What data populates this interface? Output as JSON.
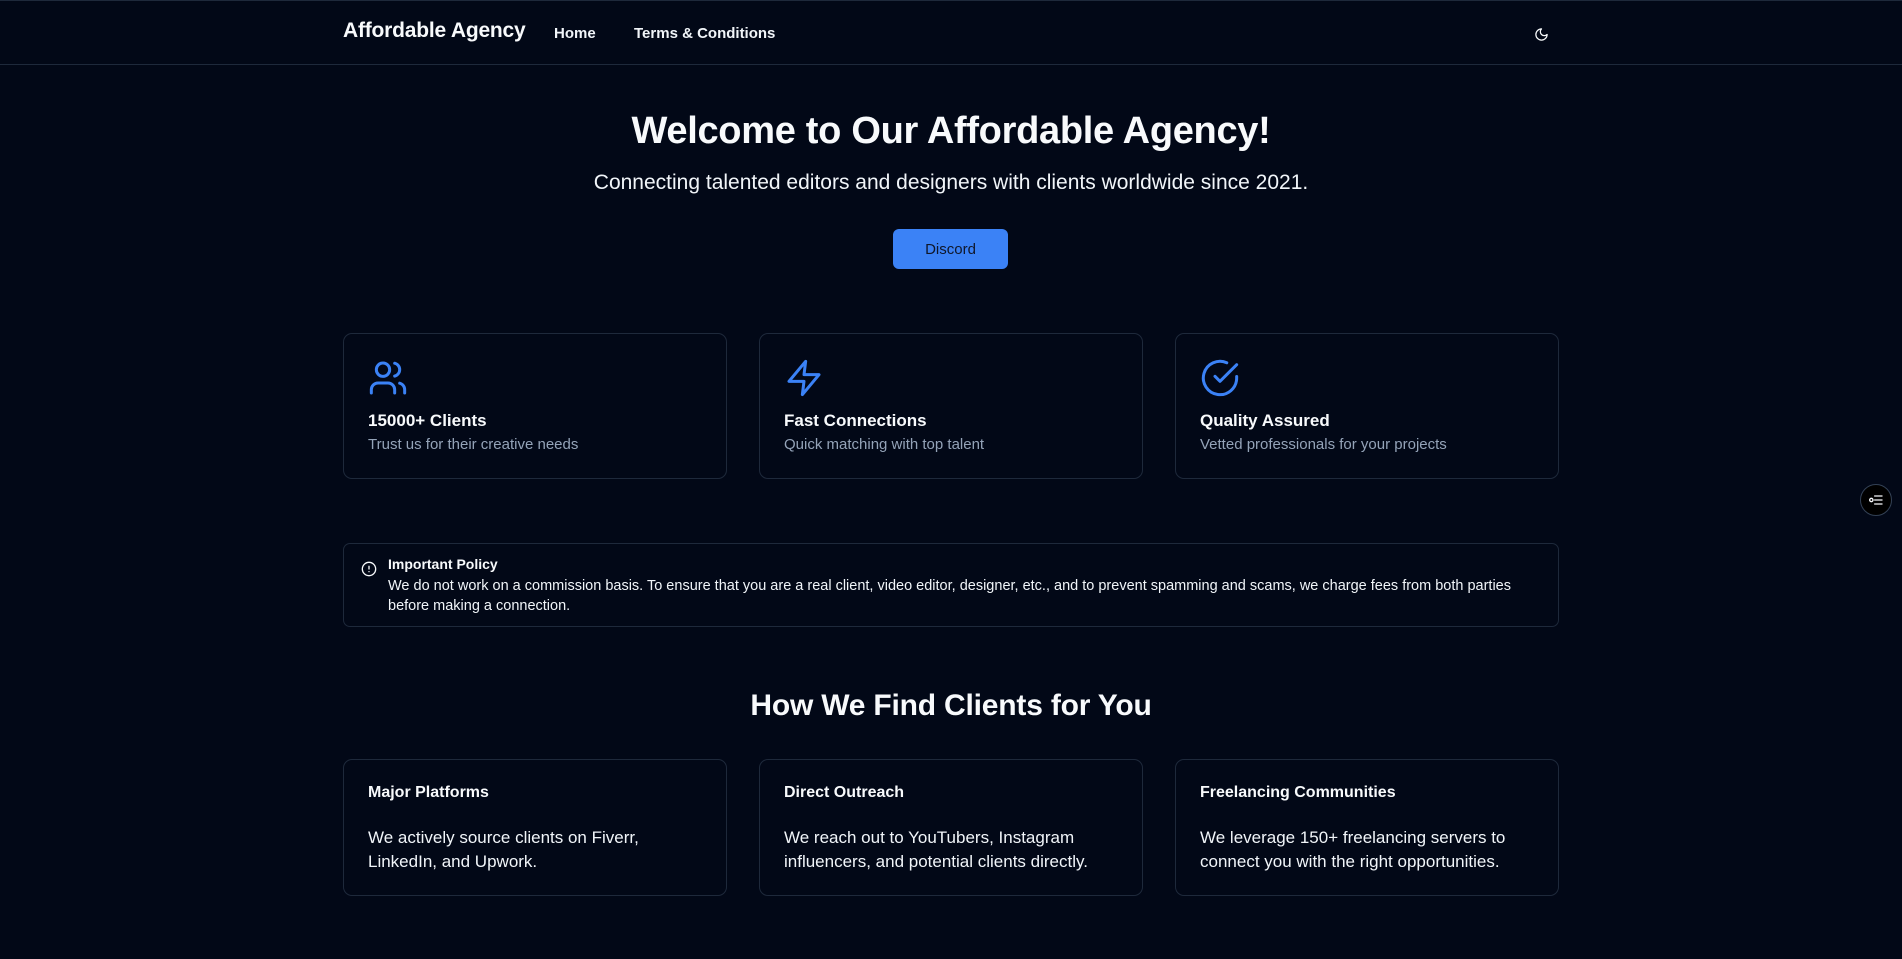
{
  "nav": {
    "brand": "Affordable Agency",
    "links": [
      "Home",
      "Terms & Conditions"
    ],
    "theme_toggle_icon": "moon-icon"
  },
  "hero": {
    "title": "Welcome to Our Affordable Agency!",
    "subtitle": "Connecting talented editors and designers with clients worldwide since 2021.",
    "button_label": "Discord"
  },
  "features": [
    {
      "icon": "users-icon",
      "title": "15000+ Clients",
      "desc": "Trust us for their creative needs"
    },
    {
      "icon": "lightning-icon",
      "title": "Fast Connections",
      "desc": "Quick matching with top talent"
    },
    {
      "icon": "check-circle-icon",
      "title": "Quality Assured",
      "desc": "Vetted professionals for your projects"
    }
  ],
  "policy": {
    "icon": "info-icon",
    "title": "Important Policy",
    "text": "We do not work on a commission basis. To ensure that you are a real client, video editor, designer, etc., and to prevent spamming and scams, we charge fees from both parties before making a connection."
  },
  "how": {
    "title": "How We Find Clients for You",
    "cards": [
      {
        "title": "Major Platforms",
        "desc": "We actively source clients on Fiverr, LinkedIn, and Upwork."
      },
      {
        "title": "Direct Outreach",
        "desc": "We reach out to YouTubers, Instagram influencers, and potential clients directly."
      },
      {
        "title": "Freelancing Communities",
        "desc": "We leverage 150+ freelancing servers to connect you with the right opportunities."
      }
    ]
  },
  "side_widget_icon": "accessibility-toggle-icon",
  "colors": {
    "background": "#020817",
    "accent": "#3b82f6",
    "border": "#1e293b",
    "muted_text": "#94a3b8"
  }
}
